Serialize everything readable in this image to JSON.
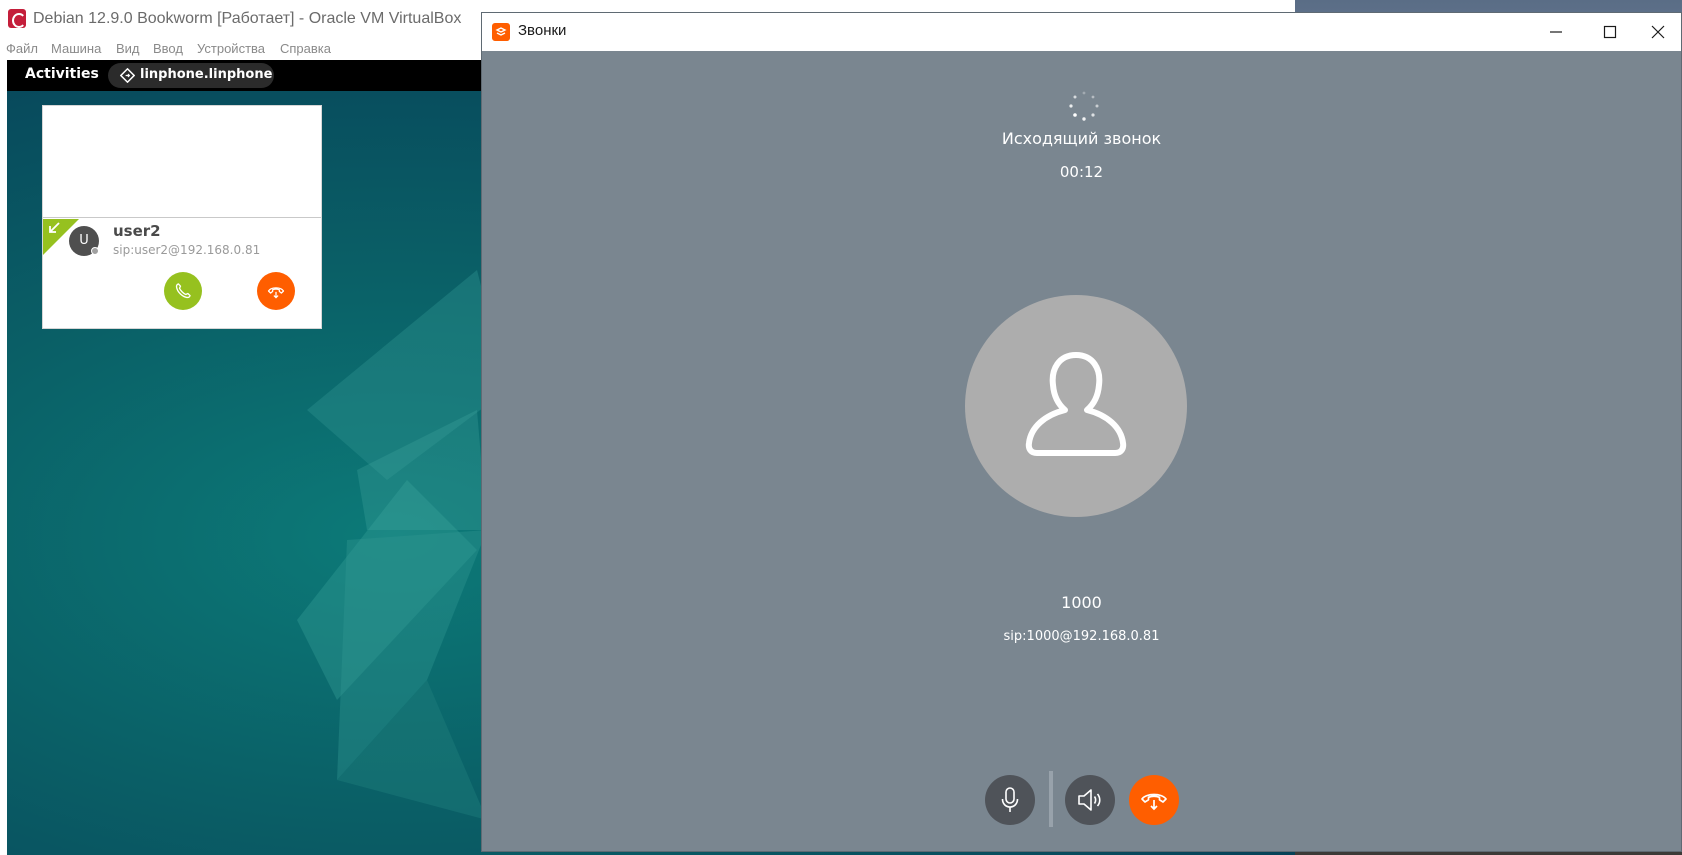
{
  "virtualbox": {
    "title": "Debian 12.9.0 Bookworm [Работает] - Oracle VM VirtualBox",
    "menu": [
      "Файл",
      "Машина",
      "Вид",
      "Ввод",
      "Устройства",
      "Справка"
    ]
  },
  "guest": {
    "topbar": {
      "activities": "Activities",
      "app_name": "linphone.linphone"
    },
    "notification": {
      "avatar_initial": "U",
      "caller_name": "user2",
      "caller_sip": "sip:user2@192.168.0.81",
      "icons": [
        "incoming-arrow-icon",
        "phone-icon",
        "hangup-icon"
      ]
    }
  },
  "calls_window": {
    "title": "Звонки",
    "status": "Исходящий звонок",
    "timer": "00:12",
    "peer_name": "1000",
    "peer_sip": "sip:1000@192.168.0.81",
    "controls": [
      "microphone-icon",
      "speaker-icon",
      "hangup-icon"
    ]
  },
  "colors": {
    "accent_orange": "#ff5e00",
    "accept_green": "#96c11f",
    "call_background": "#7a8690",
    "avatar_gray": "#adadad"
  }
}
